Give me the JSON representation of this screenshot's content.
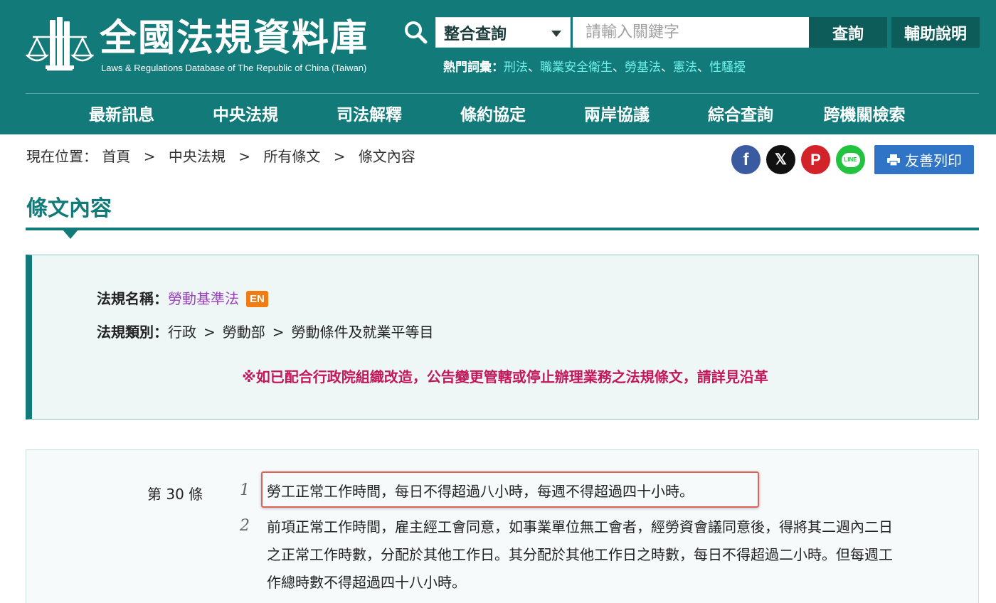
{
  "header": {
    "logo_title": "全國法規資料庫",
    "logo_subtitle": "Laws & Regulations Database of The Republic of China (Taiwan)",
    "search": {
      "scope_selected": "整合查詢",
      "placeholder": "請輸入關鍵字",
      "query_button": "查詢",
      "help_button": "輔助說明"
    },
    "hot_terms": {
      "label": "熱門詞彙：",
      "separator": "、",
      "items": [
        "刑法",
        "職業安全衛生",
        "勞基法",
        "憲法",
        "性騷擾"
      ]
    },
    "nav": [
      "最新訊息",
      "中央法規",
      "司法解釋",
      "條約協定",
      "兩岸協議",
      "綜合查詢",
      "跨機關檢索"
    ],
    "colors": {
      "primary": "#127a78",
      "dark": "#0d5c5a",
      "hot_link": "#6ff0ec"
    }
  },
  "breadcrumb": {
    "label": "現在位置：",
    "separator": ">",
    "items": [
      "首頁",
      "中央法規",
      "所有條文",
      "條文內容"
    ]
  },
  "share": {
    "icons": [
      "facebook-icon",
      "x-icon",
      "pinterest-icon",
      "line-icon"
    ],
    "facebook_glyph": "f",
    "x_glyph": "𝕏",
    "pinterest_glyph": "P",
    "line_glyph": "LINE",
    "print_label": "友善列印"
  },
  "page_title": "條文內容",
  "law": {
    "name_label": "法規名稱：",
    "name": "勞動基準法",
    "en_badge": "EN",
    "category_label": "法規類別：",
    "category_separator": ">",
    "category": [
      "行政",
      "勞動部",
      "勞動條件及就業平等目"
    ],
    "notice": "※如已配合行政院組織改造，公告變更管轄或停止辦理業務之法規條文，請詳見沿革",
    "notice_color": "#c2185b"
  },
  "article": {
    "number": "第 30 條",
    "paragraphs": [
      {
        "num": "1",
        "text": "勞工正常工作時間，每日不得超過八小時，每週不得超過四十小時。"
      },
      {
        "num": "2",
        "text": "前項正常工作時間，雇主經工會同意，如事業單位無工會者，經勞資會議同意後，得將其二週內二日之正常工作時數，分配於其他工作日。其分配於其他工作日之時數，每日不得超過二小時。但每週工作總時數不得超過四十八小時。"
      }
    ]
  }
}
